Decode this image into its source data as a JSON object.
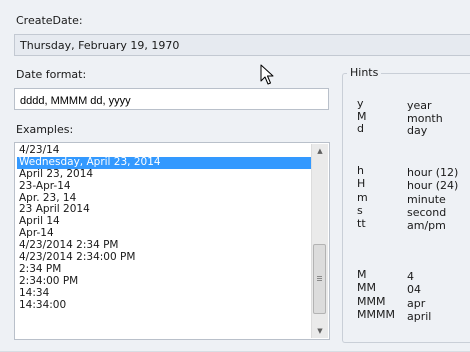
{
  "create_date": {
    "label": "CreateDate:",
    "value": "Thursday, February 19, 1970"
  },
  "date_format": {
    "label": "Date format:",
    "value": "dddd, MMMM dd, yyyy"
  },
  "examples": {
    "label": "Examples:",
    "items": [
      "4/23/14",
      "Wednesday, April 23, 2014",
      "April 23, 2014",
      "23-Apr-14",
      "Apr. 23, 14",
      "23 April 2014",
      "April 14",
      "Apr-14",
      "4/23/2014 2:34 PM",
      "4/23/2014 2:34:00 PM",
      "2:34 PM",
      "2:34:00 PM",
      "14:34",
      "14:34:00"
    ],
    "selected_index": 1
  },
  "hints": {
    "title": "Hints",
    "date_group": [
      {
        "key": "y",
        "desc": "year"
      },
      {
        "key": "M",
        "desc": "month"
      },
      {
        "key": "d",
        "desc": "day"
      }
    ],
    "time_group": [
      {
        "key": "h",
        "desc": "hour (12)"
      },
      {
        "key": "H",
        "desc": "hour (24)"
      },
      {
        "key": "m",
        "desc": "minute"
      },
      {
        "key": "s",
        "desc": "second"
      },
      {
        "key": "tt",
        "desc": "am/pm"
      }
    ],
    "month_group": [
      {
        "key": "M",
        "desc": "4"
      },
      {
        "key": "MM",
        "desc": "04"
      },
      {
        "key": "MMM",
        "desc": "apr"
      },
      {
        "key": "MMMM",
        "desc": "april"
      }
    ]
  },
  "colors": {
    "panel_bg": "#eef1f5",
    "selection": "#3399ff",
    "border": "#b9c0ca"
  },
  "icons": {
    "cursor": "mouse-pointer-icon",
    "scroll_up": "chevron-up-icon",
    "scroll_down": "chevron-down-icon"
  }
}
